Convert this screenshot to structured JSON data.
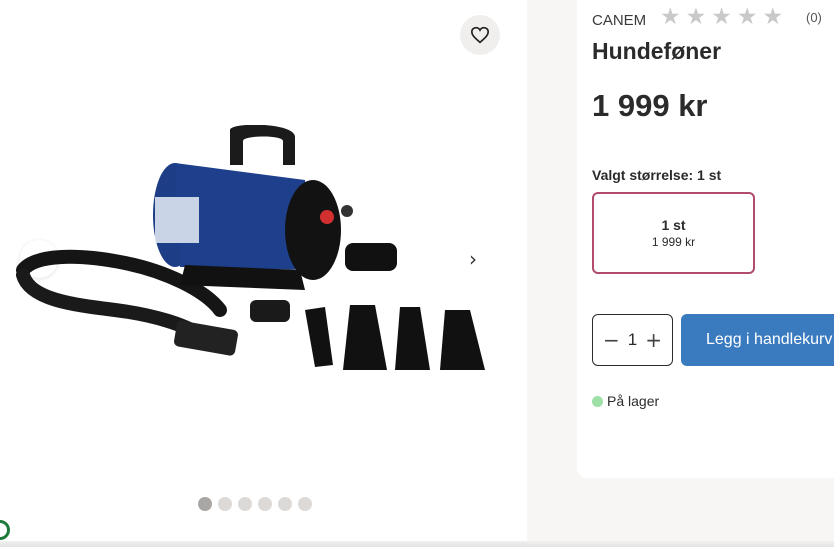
{
  "gallery": {
    "favorite_icon": "heart-outline-icon",
    "prev_glyph": "‹",
    "next_glyph": "›",
    "image_alt": "blue dog dryer with hose and nozzles",
    "dots_count": 6,
    "active_dot": 0
  },
  "product": {
    "brand": "CANEM",
    "rating_stars": 5,
    "rating_filled": 0,
    "reviews_count": "(0)",
    "title": "Hundeføner",
    "price": "1 999 kr"
  },
  "size": {
    "selected_label": "Valgt størrelse: 1 st",
    "options": [
      {
        "name": "1 st",
        "price": "1 999 kr"
      }
    ]
  },
  "cart": {
    "minus": "−",
    "plus": "+",
    "quantity": "1",
    "add_label": "Legg i handlekurv"
  },
  "stock": {
    "label": "På lager",
    "color": "#9ee0a8"
  },
  "colors": {
    "accent_button": "#3a7bbf",
    "size_border": "#b04b6b"
  }
}
